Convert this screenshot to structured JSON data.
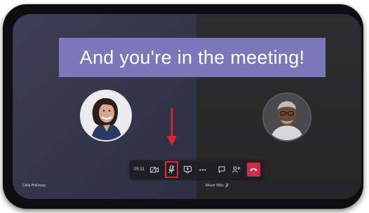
{
  "banner": {
    "text": "And you're in the meeting!"
  },
  "participants": [
    {
      "name": "Celia Holloway"
    },
    {
      "name": "Meyer Wills"
    }
  ],
  "toolbar": {
    "timer": "05:31",
    "items": [
      "camera-icon",
      "microphone-muted-icon",
      "share-screen-icon",
      "more-options-icon",
      "chat-icon",
      "participants-icon",
      "hang-up-icon"
    ]
  },
  "colors": {
    "banner": "#7b77b8",
    "hangup": "#c4314b",
    "highlight": "#e3242b"
  }
}
